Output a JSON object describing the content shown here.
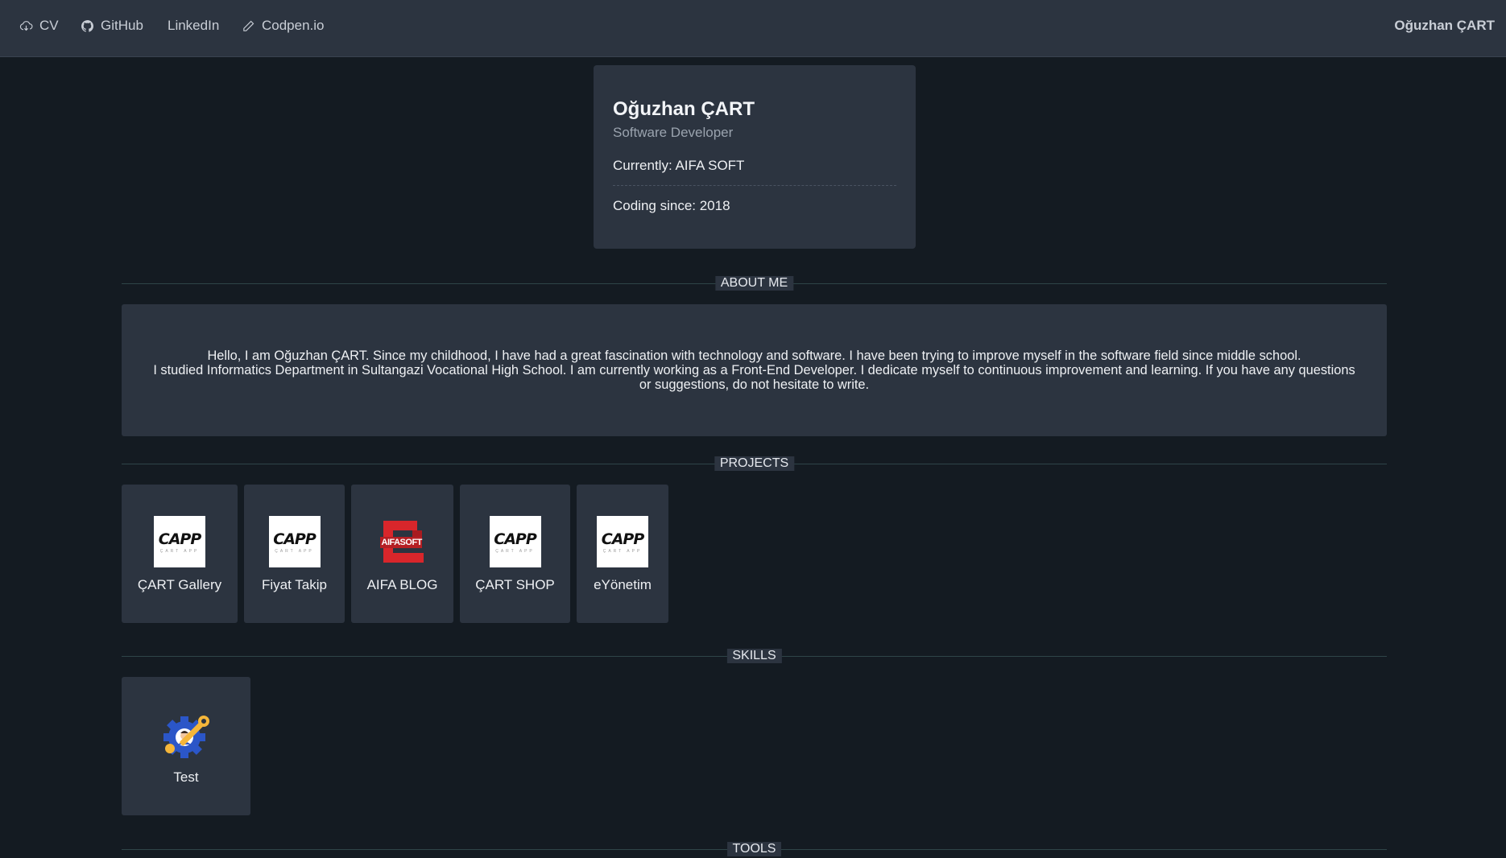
{
  "nav": {
    "links": [
      {
        "label": "CV",
        "icon": "cloud-download-icon"
      },
      {
        "label": "GitHub",
        "icon": "github-icon"
      },
      {
        "label": "LinkedIn",
        "icon": ""
      },
      {
        "label": "Codpen.io",
        "icon": "pencil-icon"
      }
    ],
    "brand": "Oğuzhan ÇART"
  },
  "profile": {
    "name": "Oğuzhan ÇART",
    "role": "Software Developer",
    "currently": "Currently: AIFA SOFT",
    "coding_since": "Coding since: 2018"
  },
  "sections": {
    "about": "ABOUT ME",
    "projects": "PROJECTS",
    "skills": "SKILLS",
    "tools": "TOOLS"
  },
  "about": {
    "line1": "Hello, I am Oğuzhan ÇART. Since my childhood, I have had a great fascination with technology and software. I have been trying to improve myself in the software field since middle school.",
    "line2": "I studied Informatics Department in Sultangazi Vocational High School. I am currently working as a Front-End Developer. I dedicate myself to continuous improvement and learning. If you have any questions or suggestions, do not hesitate to write."
  },
  "projects": [
    {
      "label": "ÇART Gallery",
      "logo": "capp-logo"
    },
    {
      "label": "Fiyat Takip",
      "logo": "capp-logo"
    },
    {
      "label": "AIFA BLOG",
      "logo": "aifasoft-logo"
    },
    {
      "label": "ÇART SHOP",
      "logo": "capp-logo"
    },
    {
      "label": "eYönetim",
      "logo": "capp-logo"
    }
  ],
  "logos": {
    "capp_word": "CAPP",
    "capp_sub": "ÇART APP",
    "aifa_word": "AIFASOFT"
  },
  "skills": [
    {
      "label": "Test",
      "icon": "gear-wrench-icon"
    }
  ],
  "colors": {
    "background": "#141b22",
    "panel": "#2c3440",
    "divider": "#2f4548",
    "aifa_red": "#d8262b"
  }
}
